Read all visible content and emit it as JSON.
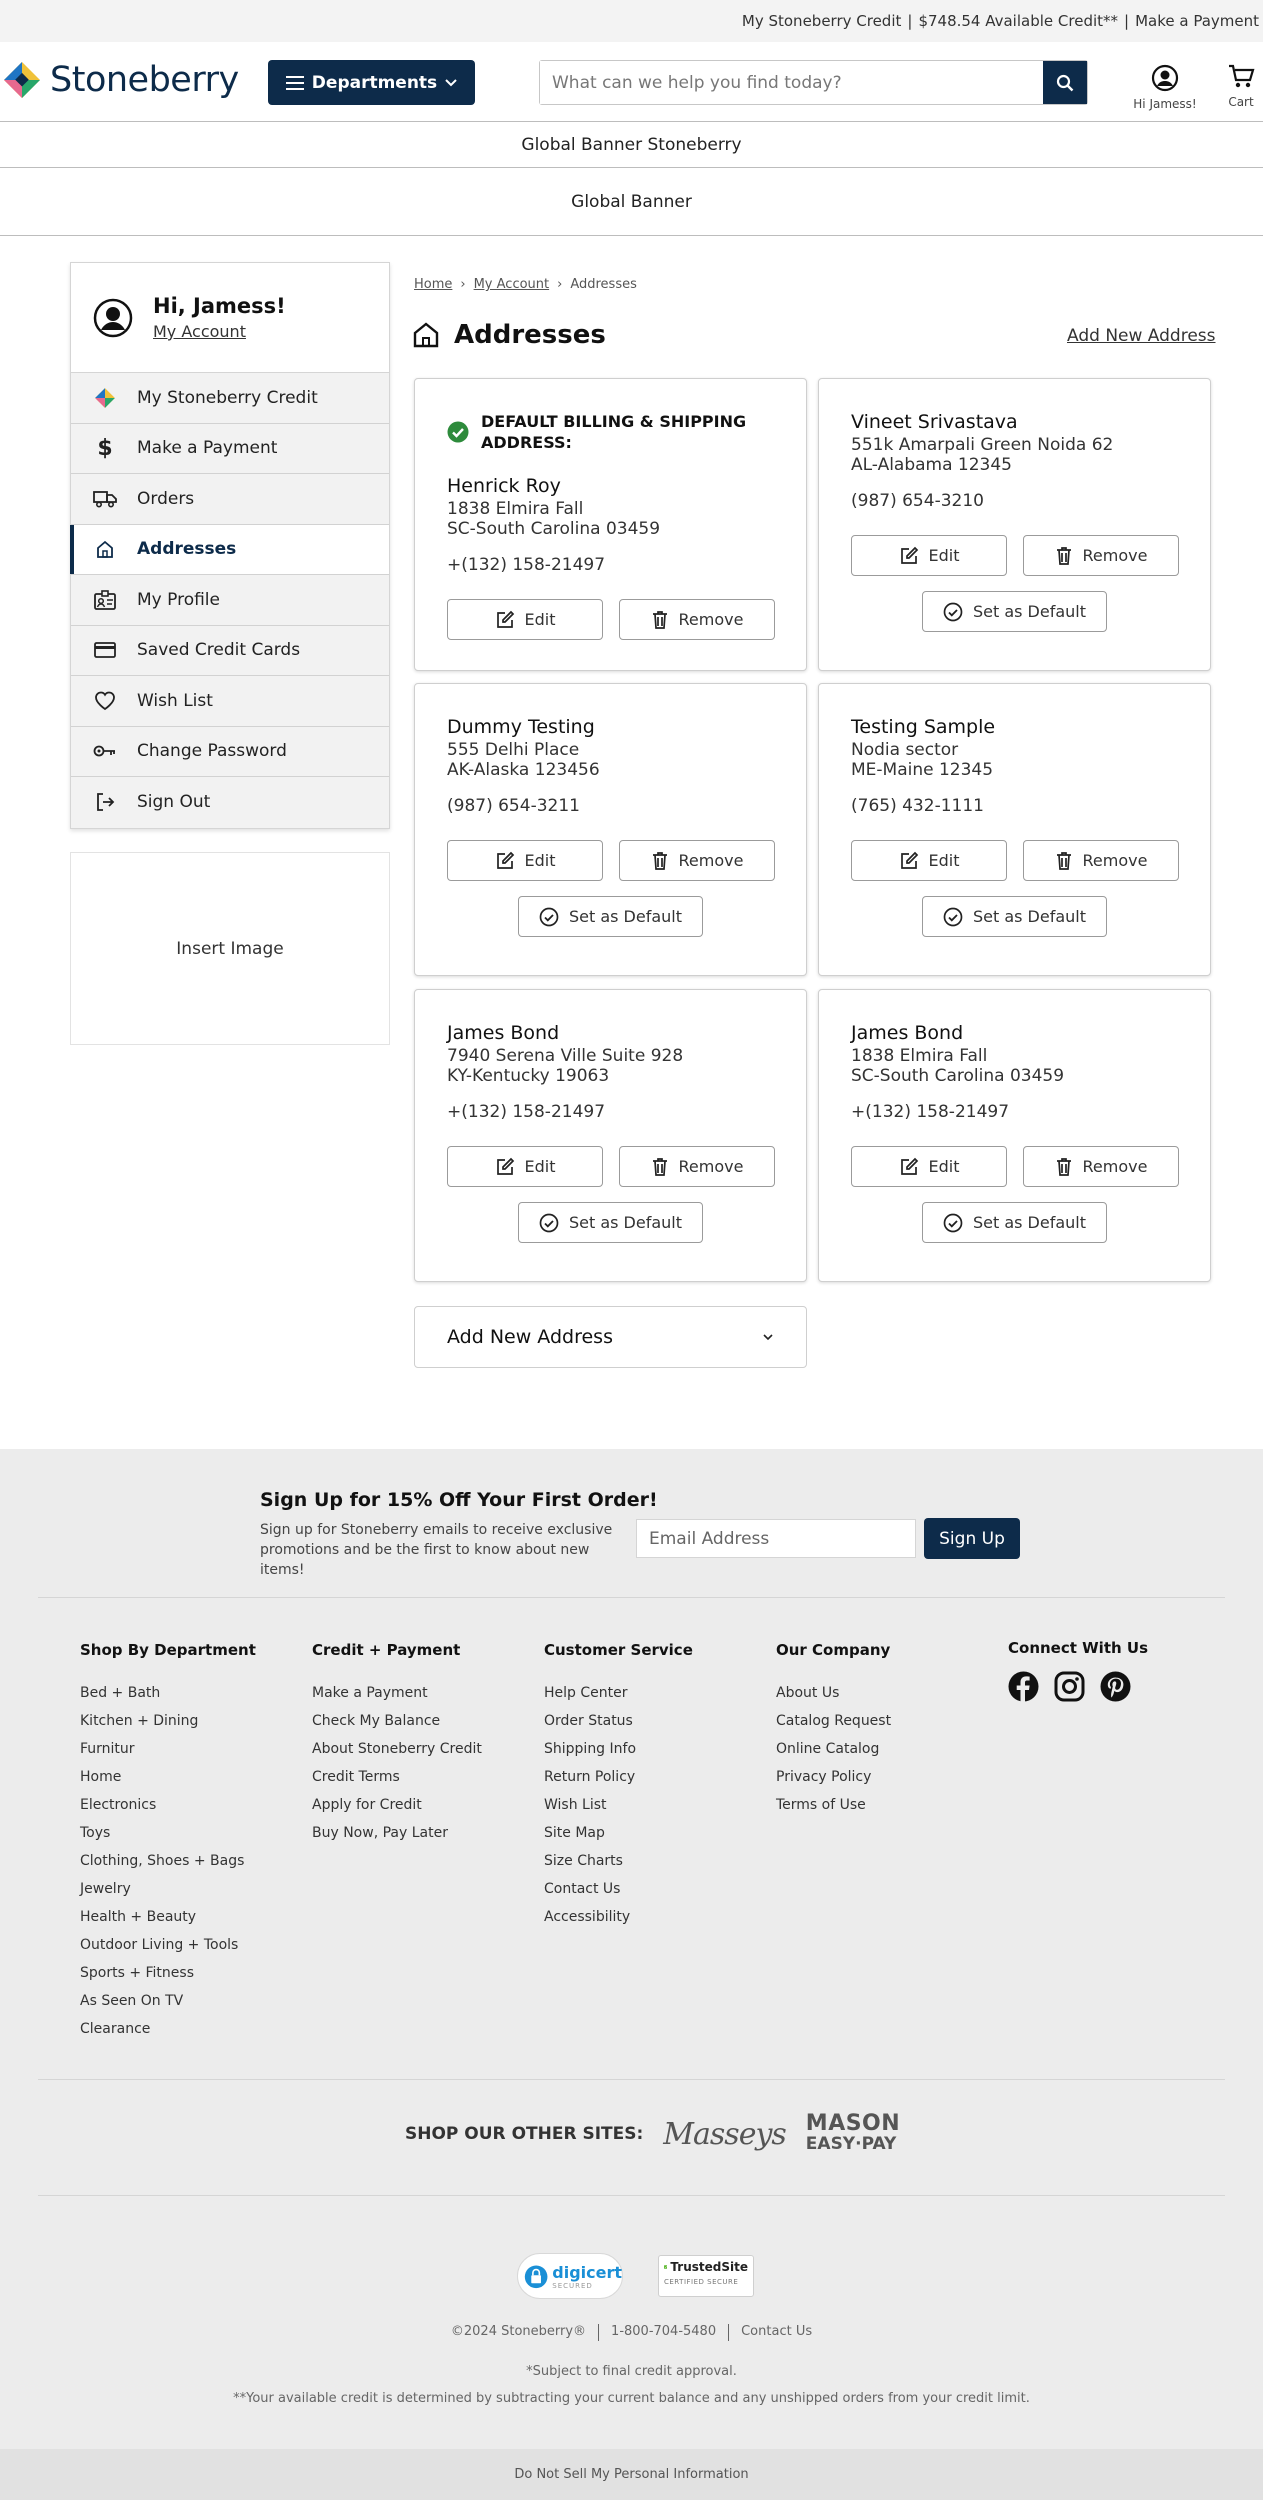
{
  "topbar": {
    "credit_link": "My Stoneberry Credit",
    "available": "$748.54 Available Credit**",
    "payment_link": "Make a Payment"
  },
  "header": {
    "logo_text": "Stoneberry",
    "departments_label": "Departments",
    "search_placeholder": "What can we help you find today?",
    "account_label": "Hi Jamess!",
    "cart_label": "Cart"
  },
  "banners": [
    "Global Banner Stoneberry",
    "Global Banner"
  ],
  "sidebar": {
    "greeting": "Hi, Jamess!",
    "my_account": "My Account",
    "items": [
      {
        "label": "My Stoneberry Credit",
        "icon": "stoneberry-diamond-icon"
      },
      {
        "label": "Make a Payment",
        "icon": "dollar-icon"
      },
      {
        "label": "Orders",
        "icon": "truck-icon"
      },
      {
        "label": "Addresses",
        "icon": "home-icon",
        "active": true
      },
      {
        "label": "My Profile",
        "icon": "id-card-icon"
      },
      {
        "label": "Saved Credit Cards",
        "icon": "credit-card-icon"
      },
      {
        "label": "Wish List",
        "icon": "heart-icon"
      },
      {
        "label": "Change Password",
        "icon": "key-icon"
      },
      {
        "label": "Sign Out",
        "icon": "sign-out-icon"
      }
    ],
    "insert_image": "Insert Image"
  },
  "breadcrumb": [
    "Home",
    "My Account",
    "Addresses"
  ],
  "page": {
    "title": "Addresses",
    "add_new_link": "Add New Address"
  },
  "default_heading": "DEFAULT BILLING & SHIPPING ADDRESS:",
  "buttons": {
    "edit": "Edit",
    "remove": "Remove",
    "set_default": "Set as Default"
  },
  "addresses": [
    {
      "name": "Henrick Roy",
      "street": "1838 Elmira Fall",
      "city": "SC-South Carolina 03459",
      "phone": "+(132) 158-21497",
      "is_default": true
    },
    {
      "name": "Vineet Srivastava",
      "street": "551k Amarpali Green Noida 62",
      "city": "AL-Alabama 12345",
      "phone": "(987) 654-3210",
      "is_default": false
    },
    {
      "name": "Dummy Testing",
      "street": "555 Delhi Place",
      "city": "AK-Alaska 123456",
      "phone": "(987) 654-3211",
      "is_default": false
    },
    {
      "name": "Testing Sample",
      "street": "Nodia sector",
      "city": "ME-Maine 12345",
      "phone": "(765) 432-1111",
      "is_default": false
    },
    {
      "name": "James Bond",
      "street": "7940 Serena Ville Suite 928",
      "city": "KY-Kentucky 19063",
      "phone": "+(132) 158-21497",
      "is_default": false
    },
    {
      "name": "James Bond",
      "street": "1838 Elmira Fall",
      "city": "SC-South Carolina 03459",
      "phone": "+(132) 158-21497",
      "is_default": false
    }
  ],
  "add_new_accordion": "Add New Address",
  "footer": {
    "signup_title": "Sign Up for 15% Off Your First Order!",
    "signup_text": "Sign up for Stoneberry emails to receive exclusive promotions and be the first to know about new items!",
    "email_placeholder": "Email Address",
    "signup_button": "Sign Up",
    "columns": [
      {
        "title": "Shop By Department",
        "links": [
          "Bed + Bath",
          "Kitchen + Dining",
          "Furnitur",
          "Home",
          "Electronics",
          "Toys",
          "Clothing, Shoes + Bags",
          "Jewelry",
          "Health + Beauty",
          "Outdoor Living + Tools",
          "Sports + Fitness",
          "As Seen On TV",
          "Clearance"
        ]
      },
      {
        "title": "Credit + Payment",
        "links": [
          "Make a Payment",
          "Check My Balance",
          "About Stoneberry Credit",
          "Credit Terms",
          "Apply for Credit",
          "Buy Now, Pay Later"
        ]
      },
      {
        "title": "Customer Service",
        "links": [
          "Help Center",
          "Order Status",
          "Shipping Info",
          "Return Policy",
          "Wish List",
          "Site Map",
          "Size Charts",
          "Contact Us",
          "Accessibility"
        ]
      },
      {
        "title": "Our Company",
        "links": [
          "About Us",
          "Catalog Request",
          "Online Catalog",
          "Privacy Policy",
          "Terms of Use"
        ]
      }
    ],
    "connect_title": "Connect With Us",
    "social": [
      "facebook-icon",
      "instagram-icon",
      "pinterest-icon"
    ],
    "other_sites_label": "SHOP OUR OTHER SITES:",
    "other_sites": [
      "Masseys",
      "MASON",
      "EASY·PAY"
    ],
    "seal_digicert": "digicert",
    "seal_digicert_sub": "SECURED",
    "seal_trusted": "TrustedSite",
    "seal_trusted_sub": "CERTIFIED SECURE",
    "copyright": "©2024 Stoneberry®",
    "phone": "1-800-704-5480",
    "contact": "Contact Us",
    "legal1": "*Subject to final credit approval.",
    "legal2": "**Your available credit is determined by subtracting your current balance and any unshipped orders from your credit limit.",
    "do_not_sell": "Do Not Sell My Personal Information"
  }
}
